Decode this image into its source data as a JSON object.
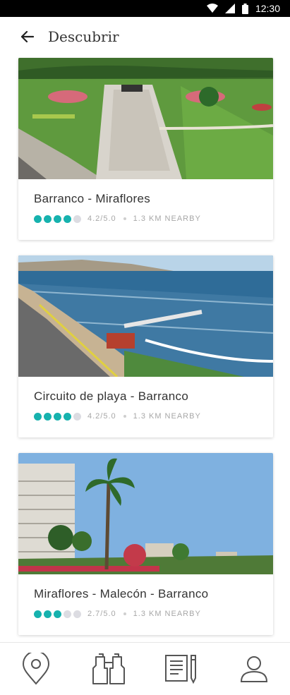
{
  "status": {
    "time": "12:30"
  },
  "header": {
    "title": "Descubrir"
  },
  "colors": {
    "accent": "#16b2ae",
    "dot_off": "#dcdce2"
  },
  "places": [
    {
      "title": "Barranco - Miraflores",
      "rating_text": "4.2/5.0",
      "stars": 4,
      "distance": "1.3 km nearby"
    },
    {
      "title": "Circuito de playa -  Barranco",
      "rating_text": "4.2/5.0",
      "stars": 4,
      "distance": "1.3 km nearby"
    },
    {
      "title": "Miraflores - Malecón - Barranco",
      "rating_text": "2.7/5.0",
      "stars": 3,
      "distance": "1.3 km nearby"
    }
  ],
  "nav": {
    "items": [
      "location-pin-icon",
      "binoculars-icon",
      "notes-icon",
      "profile-icon"
    ]
  }
}
